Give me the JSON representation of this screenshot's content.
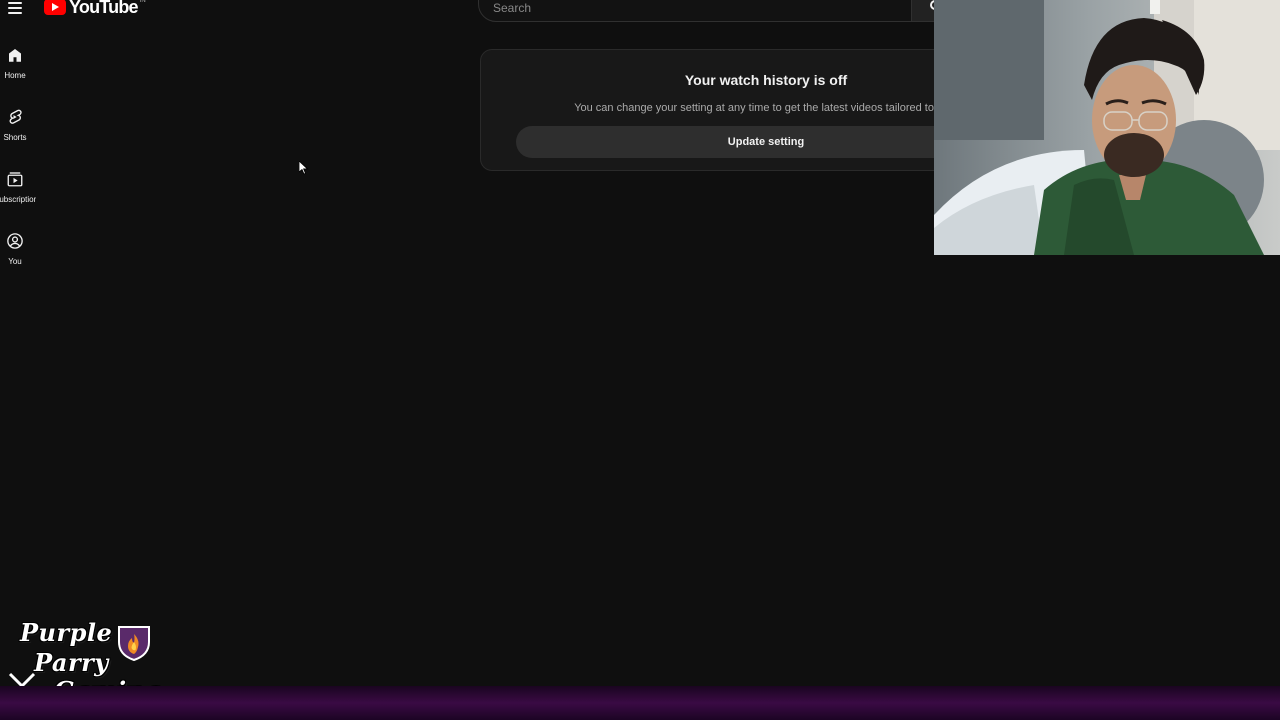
{
  "masthead": {
    "logo_text": "YouTube",
    "logo_superscript": "IN",
    "search_placeholder": "Search",
    "brand_color": "#ff0000"
  },
  "guide": {
    "items": [
      {
        "label": "Home",
        "icon": "home-icon"
      },
      {
        "label": "Shorts",
        "icon": "shorts-icon"
      },
      {
        "label": "Subscriptions",
        "icon": "subscriptions-icon"
      },
      {
        "label": "You",
        "icon": "account-circle-icon"
      }
    ]
  },
  "history_panel": {
    "title": "Your watch history is off",
    "description": "You can change your setting at any time to get the latest videos tailored to you.",
    "button_label": "Update setting"
  },
  "overlay": {
    "brand_lines": [
      "Purple",
      "Parry",
      "Gaming"
    ],
    "accent_color": "#3a0a44"
  },
  "theme": {
    "background": "#0f0f0f",
    "card_background": "#181818",
    "button_background": "#2e2e2e"
  }
}
